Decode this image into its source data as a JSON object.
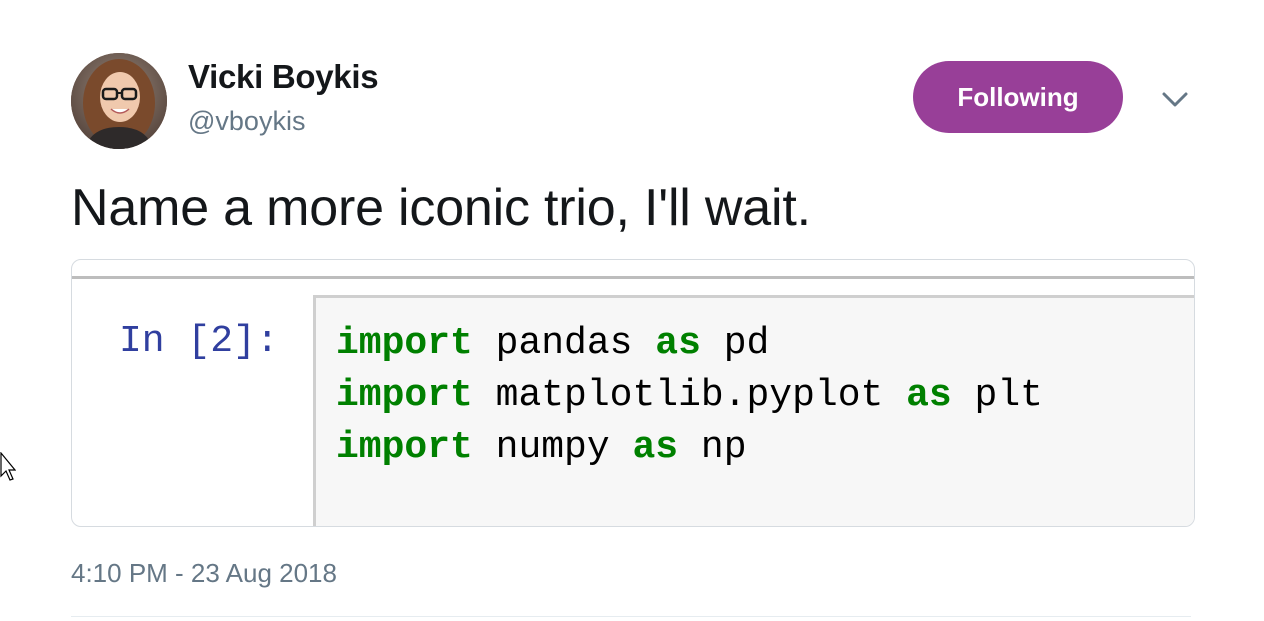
{
  "author": {
    "display_name": "Vicki Boykis",
    "handle": "@vboykis"
  },
  "follow_button": {
    "label": "Following",
    "color": "#983f98"
  },
  "tweet": {
    "text": "Name a more iconic trio, I'll wait.",
    "timestamp": "4:10 PM - 23 Aug 2018"
  },
  "media": {
    "prompt": "In [2]:",
    "code_lines": [
      {
        "keyword": "import",
        "module": "pandas",
        "as_kw": "as",
        "alias": "pd"
      },
      {
        "keyword": "import",
        "module": "matplotlib.pyplot",
        "as_kw": "as",
        "alias": "plt"
      },
      {
        "keyword": "import",
        "module": "numpy",
        "as_kw": "as",
        "alias": "np"
      }
    ]
  },
  "icons": {
    "menu": "chevron-down-icon",
    "pointer": "mouse-cursor-icon"
  }
}
